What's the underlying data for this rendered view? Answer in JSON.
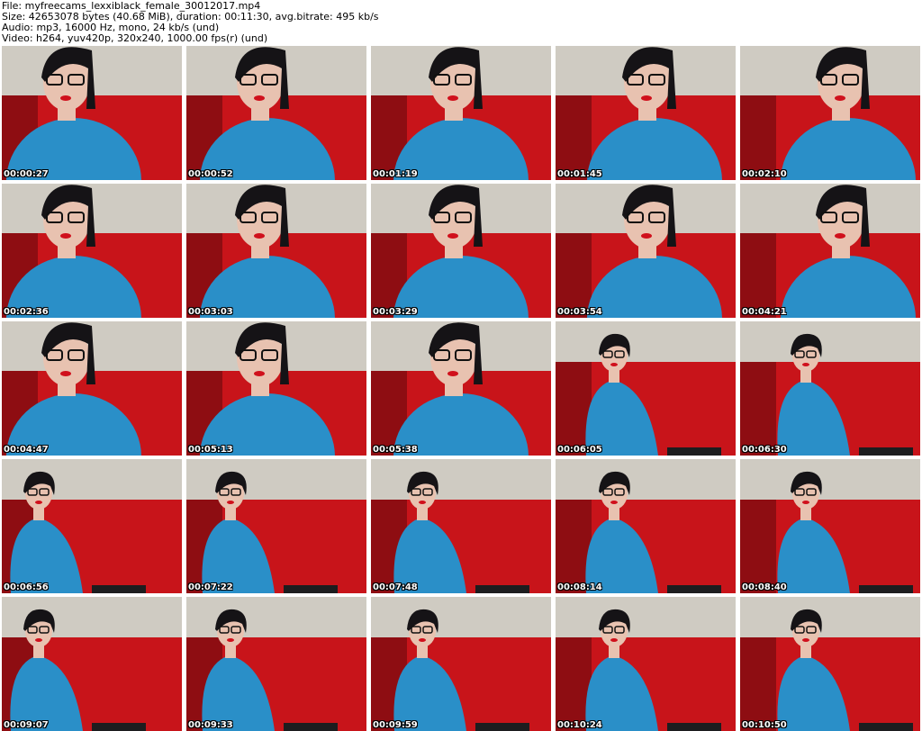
{
  "header": {
    "file_line": "File: myfreecams_lexxiblack_female_30012017.mp4",
    "size_line": "Size: 42653078 bytes (40.68 MiB), duration: 00:11:30, avg.bitrate: 495 kb/s",
    "audio_line": "Audio: mp3, 16000 Hz, mono, 24 kb/s (und)",
    "video_line": "Video: h264, yuv420p, 320x240, 1000.00 fps(r) (und)"
  },
  "colors": {
    "background": "#ffffff",
    "wall": "#cfcbc2",
    "sofa_red": "#c8141a",
    "shirt_blue": "#2a8fc8",
    "hair": "#151316",
    "skin": "#e8c2b0",
    "timestamp_text": "#ffffff"
  },
  "thumbnails": [
    {
      "time": "00:00:27",
      "pose": "close",
      "icon": "video-frame-icon"
    },
    {
      "time": "00:00:52",
      "pose": "close",
      "icon": "video-frame-icon"
    },
    {
      "time": "00:01:19",
      "pose": "close",
      "icon": "video-frame-icon"
    },
    {
      "time": "00:01:45",
      "pose": "close",
      "icon": "video-frame-icon"
    },
    {
      "time": "00:02:10",
      "pose": "close",
      "icon": "video-frame-icon"
    },
    {
      "time": "00:02:36",
      "pose": "close",
      "icon": "video-frame-icon"
    },
    {
      "time": "00:03:03",
      "pose": "close",
      "icon": "video-frame-icon"
    },
    {
      "time": "00:03:29",
      "pose": "close",
      "icon": "video-frame-icon"
    },
    {
      "time": "00:03:54",
      "pose": "close",
      "icon": "video-frame-icon"
    },
    {
      "time": "00:04:21",
      "pose": "close",
      "icon": "video-frame-icon"
    },
    {
      "time": "00:04:47",
      "pose": "close",
      "icon": "video-frame-icon"
    },
    {
      "time": "00:05:13",
      "pose": "close",
      "icon": "video-frame-icon"
    },
    {
      "time": "00:05:38",
      "pose": "close",
      "icon": "video-frame-icon"
    },
    {
      "time": "00:06:05",
      "pose": "far",
      "icon": "video-frame-icon"
    },
    {
      "time": "00:06:30",
      "pose": "far",
      "icon": "video-frame-icon"
    },
    {
      "time": "00:06:56",
      "pose": "far",
      "icon": "video-frame-icon"
    },
    {
      "time": "00:07:22",
      "pose": "far",
      "icon": "video-frame-icon"
    },
    {
      "time": "00:07:48",
      "pose": "far",
      "icon": "video-frame-icon"
    },
    {
      "time": "00:08:14",
      "pose": "far",
      "icon": "video-frame-icon"
    },
    {
      "time": "00:08:40",
      "pose": "far",
      "icon": "video-frame-icon"
    },
    {
      "time": "00:09:07",
      "pose": "far",
      "icon": "video-frame-icon"
    },
    {
      "time": "00:09:33",
      "pose": "far",
      "icon": "video-frame-icon"
    },
    {
      "time": "00:09:59",
      "pose": "far",
      "icon": "video-frame-icon"
    },
    {
      "time": "00:10:24",
      "pose": "far",
      "icon": "video-frame-icon"
    },
    {
      "time": "00:10:50",
      "pose": "far",
      "icon": "video-frame-icon"
    }
  ]
}
